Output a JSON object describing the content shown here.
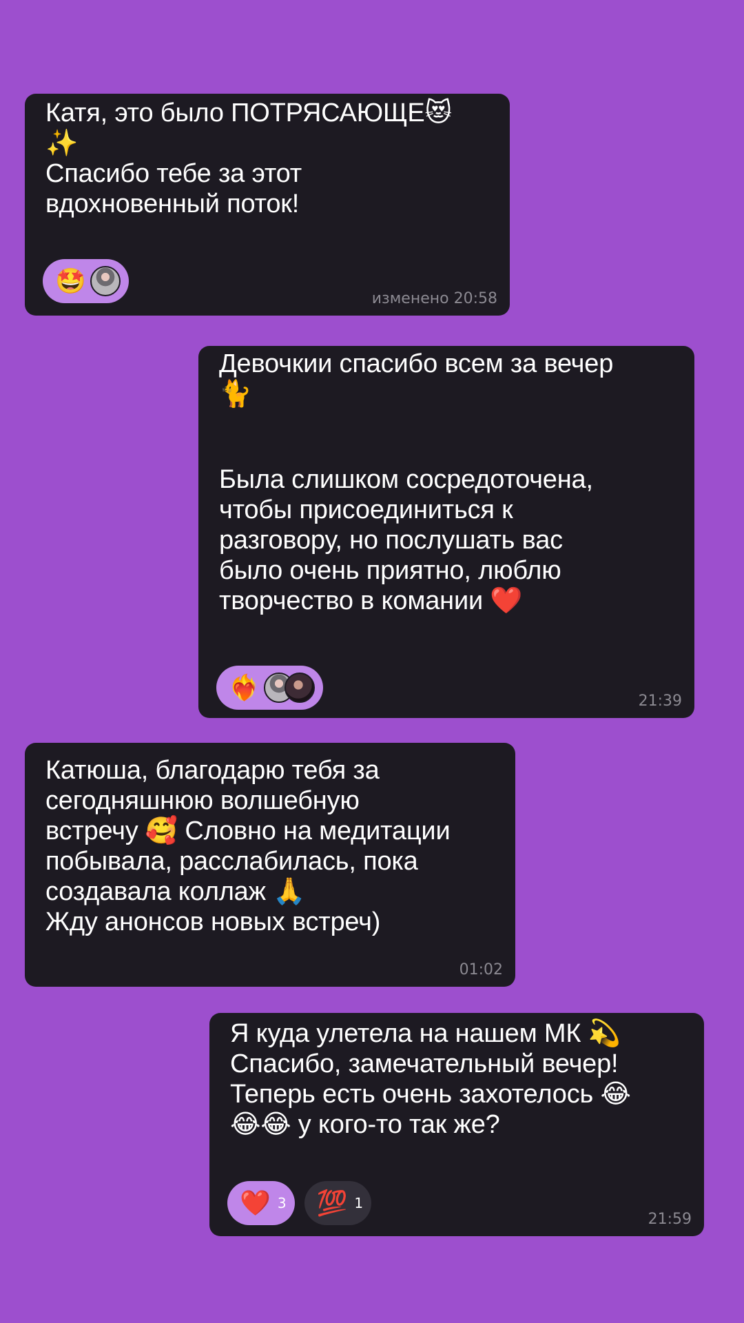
{
  "messages": [
    {
      "lines": [
        "Катя, это было ПОТРЯСАЮЩЕ😻",
        "✨",
        "Спасибо тебе за этот",
        "вдохновенный поток!"
      ],
      "time": "изменено 20:58",
      "reaction_emoji": "🤩"
    },
    {
      "lines_top": [
        "Девочкии спасибо всем за вечер",
        "🐈"
      ],
      "lines_bottom": [
        "Была слишком сосредоточена,",
        "чтобы присоединиться к",
        "разговору, но послушать вас",
        "было очень приятно, люблю",
        "творчество в комании ❤️"
      ],
      "time": "21:39",
      "reaction_emoji": "❤️‍🔥"
    },
    {
      "lines": [
        "Катюша, благодарю тебя за",
        "сегодняшнюю волшебную",
        "встречу 🥰 Словно на медитации",
        "побывала, расслабилась, пока",
        "создавала коллаж 🙏",
        "Жду анонсов новых встреч)"
      ],
      "time": "01:02"
    },
    {
      "lines": [
        "Я куда улетела на нашем МК 💫",
        "Спасибо, замечательный вечер!",
        "Теперь есть очень захотелось 😂",
        "😂😂 у кого-то так же?"
      ],
      "time": "21:59",
      "reactions": [
        {
          "emoji": "❤️",
          "count": "3"
        },
        {
          "emoji": "💯",
          "count": "1"
        }
      ]
    }
  ],
  "colors": {
    "background": "#9d4fce",
    "bubble": "#1d1a22",
    "reaction_active": "#bf86e9",
    "reaction_inactive": "#33303a"
  }
}
